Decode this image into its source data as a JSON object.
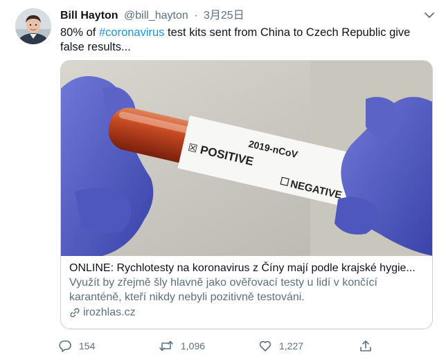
{
  "tweet": {
    "author_name": "Bill Hayton",
    "author_handle": "@bill_hayton",
    "separator": "·",
    "date": "3月25日",
    "text_before": "80% of ",
    "hashtag": "#coronavirus",
    "text_after": " test kits sent from China to Czech Republic give false results..."
  },
  "card": {
    "image_text": {
      "code": "2019-nCoV",
      "positive": "POSITIVE",
      "negative": "NEGATIVE",
      "checked_mark": "☒"
    },
    "title": "ONLINE: Rychlotesty na koronavirus z Číny mají podle krajské hygie...",
    "description": "Využít by zřejmě šly hlavně jako ověřovací testy u lidí v končící karanténě, kteří nikdy nebyli pozitivně testováni.",
    "domain": "irozhlas.cz"
  },
  "actions": {
    "reply_count": "154",
    "retweet_count": "1,096",
    "like_count": "1,227",
    "icons": [
      "reply-icon",
      "retweet-icon",
      "like-icon",
      "share-icon"
    ]
  },
  "colors": {
    "link": "#1b95e0",
    "secondary_text": "#5b7083",
    "primary_text": "#0f1419",
    "border": "#c4cfd6"
  }
}
